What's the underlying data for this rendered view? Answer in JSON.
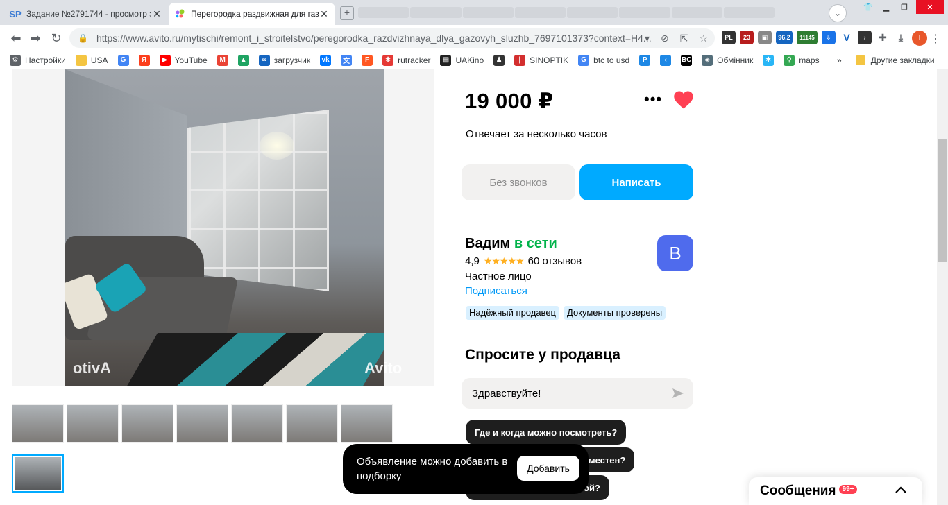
{
  "browser": {
    "tabs": [
      {
        "title": "Задание №2791744 - просмотр з",
        "favicon": "SP",
        "active": false
      },
      {
        "title": "Перегородка раздвижная для газ",
        "favicon": "avito",
        "active": true
      }
    ],
    "url": "https://www.avito.ru/mytischi/remont_i_stroitelstvo/peregorodka_razdvizhnaya_dlya_gazovyh_sluzhb_7697101373?context=H4...",
    "extension_badges": [
      "PL",
      "23",
      "96.2",
      "11145"
    ],
    "profile_letter": "I"
  },
  "bookmarks": {
    "items": [
      {
        "label": "Настройки",
        "icon": "gear-icon"
      },
      {
        "label": "USA",
        "icon": "folder-icon"
      },
      {
        "label": "",
        "icon": "google-icon"
      },
      {
        "label": "",
        "icon": "yandex-icon"
      },
      {
        "label": "YouTube",
        "icon": "youtube-icon"
      },
      {
        "label": "",
        "icon": "gmail-icon"
      },
      {
        "label": "",
        "icon": "drive-icon"
      },
      {
        "label": "загрузчик",
        "icon": "infinity-icon"
      },
      {
        "label": "",
        "icon": "vk-icon"
      },
      {
        "label": "",
        "icon": "translate-icon"
      },
      {
        "label": "",
        "icon": "f-icon"
      },
      {
        "label": "rutracker",
        "icon": "rutracker-icon"
      },
      {
        "label": "UAKino",
        "icon": "uakino-icon"
      },
      {
        "label": "",
        "icon": "chess-icon"
      },
      {
        "label": "SINOPTIK",
        "icon": "thermometer-icon"
      },
      {
        "label": "btc to usd",
        "icon": "google-icon"
      },
      {
        "label": "",
        "icon": "p-icon"
      },
      {
        "label": "",
        "icon": "arrow-icon"
      },
      {
        "label": "",
        "icon": "bc-icon"
      },
      {
        "label": "Обмінник",
        "icon": "exchange-icon"
      },
      {
        "label": "",
        "icon": "star-icon"
      },
      {
        "label": "maps",
        "icon": "maps-icon"
      }
    ],
    "more": "»",
    "other_label": "Другие закладки"
  },
  "listing": {
    "watermark_left": "otivA",
    "watermark_right": "Avito",
    "price": "19 000 ₽",
    "more": "•••",
    "response_time": "Отвечает за несколько часов",
    "no_calls_button": "Без звонков",
    "write_button": "Написать"
  },
  "seller": {
    "name": "Вадим",
    "status": "в сети",
    "rating": "4,9",
    "stars": "★★★★★",
    "reviews": "60 отзывов",
    "type": "Частное лицо",
    "subscribe": "Подписаться",
    "avatar_letter": "В",
    "badges": [
      "Надёжный продавец",
      "Документы проверены"
    ]
  },
  "ask": {
    "title": "Спросите у продавца",
    "input_value": "Здравствуйте!",
    "chips": [
      "Где и когда можно посмотреть?",
      "местен?",
      "ой?"
    ]
  },
  "toast": {
    "text": "Объявление можно добавить в подборку",
    "button": "Добавить"
  },
  "messages": {
    "title": "Сообщения",
    "badge": "99+"
  },
  "colors": {
    "accent": "#00aaff",
    "online": "#02b34b",
    "heart": "#ff4053",
    "avatar": "#4f6bed"
  }
}
